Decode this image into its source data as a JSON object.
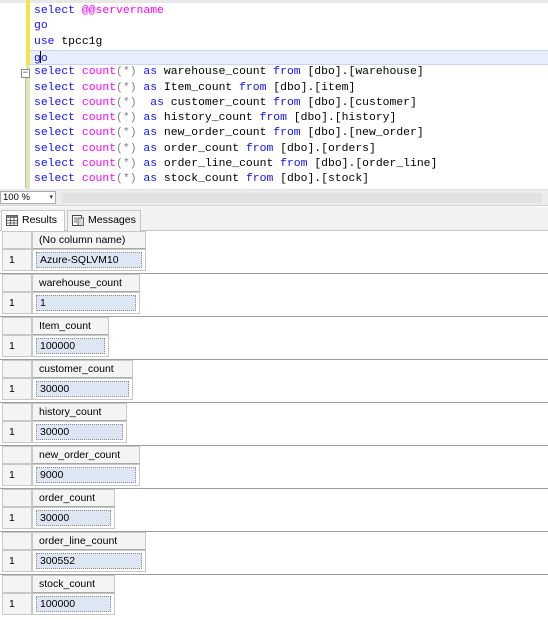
{
  "editor": {
    "lines": [
      {
        "parts": [
          [
            "kw",
            "select "
          ],
          [
            "at",
            "@@servername"
          ]
        ]
      },
      {
        "parts": [
          [
            "kw",
            "go"
          ]
        ]
      },
      {
        "parts": [
          [
            "kw",
            "use "
          ],
          [
            "pl",
            "tpcc1g"
          ]
        ]
      },
      {
        "parts": [
          [
            "kw",
            "go"
          ]
        ],
        "current": true
      },
      {
        "parts": [
          [
            "kw",
            "select "
          ],
          [
            "fn",
            "count"
          ],
          [
            "gy",
            "(*)"
          ],
          [
            "kw",
            " as "
          ],
          [
            "pl",
            "warehouse_count "
          ],
          [
            "kw",
            "from "
          ],
          [
            "pl",
            "[dbo].[warehouse]"
          ]
        ]
      },
      {
        "parts": [
          [
            "kw",
            "select "
          ],
          [
            "fn",
            "count"
          ],
          [
            "gy",
            "(*)"
          ],
          [
            "kw",
            " as "
          ],
          [
            "pl",
            "Item_count "
          ],
          [
            "kw",
            "from "
          ],
          [
            "pl",
            "[dbo].[item]"
          ]
        ]
      },
      {
        "parts": [
          [
            "kw",
            "select "
          ],
          [
            "fn",
            "count"
          ],
          [
            "gy",
            "(*)"
          ],
          [
            "kw",
            "  as "
          ],
          [
            "pl",
            "customer_count "
          ],
          [
            "kw",
            "from "
          ],
          [
            "pl",
            "[dbo].[customer]"
          ]
        ]
      },
      {
        "parts": [
          [
            "kw",
            "select "
          ],
          [
            "fn",
            "count"
          ],
          [
            "gy",
            "(*)"
          ],
          [
            "kw",
            " as "
          ],
          [
            "pl",
            "history_count "
          ],
          [
            "kw",
            "from "
          ],
          [
            "pl",
            "[dbo].[history]"
          ]
        ]
      },
      {
        "parts": [
          [
            "kw",
            "select "
          ],
          [
            "fn",
            "count"
          ],
          [
            "gy",
            "(*)"
          ],
          [
            "kw",
            " as "
          ],
          [
            "pl",
            "new_order_count "
          ],
          [
            "kw",
            "from "
          ],
          [
            "pl",
            "[dbo].[new_order]"
          ]
        ]
      },
      {
        "parts": [
          [
            "kw",
            "select "
          ],
          [
            "fn",
            "count"
          ],
          [
            "gy",
            "(*)"
          ],
          [
            "kw",
            " as "
          ],
          [
            "pl",
            "order_count "
          ],
          [
            "kw",
            "from "
          ],
          [
            "pl",
            "[dbo].[orders]"
          ]
        ]
      },
      {
        "parts": [
          [
            "kw",
            "select "
          ],
          [
            "fn",
            "count"
          ],
          [
            "gy",
            "(*)"
          ],
          [
            "kw",
            " as "
          ],
          [
            "pl",
            "order_line_count "
          ],
          [
            "kw",
            "from "
          ],
          [
            "pl",
            "[dbo].[order_line]"
          ]
        ]
      },
      {
        "parts": [
          [
            "kw",
            "select "
          ],
          [
            "fn",
            "count"
          ],
          [
            "gy",
            "(*)"
          ],
          [
            "kw",
            " as "
          ],
          [
            "pl",
            "stock_count "
          ],
          [
            "kw",
            "from "
          ],
          [
            "pl",
            "[dbo].[stock]"
          ]
        ]
      }
    ],
    "collapse_glyph": "−"
  },
  "zoom": {
    "value": "100 %",
    "arrow": "▾"
  },
  "tabs": {
    "results": "Results",
    "messages": "Messages"
  },
  "results": [
    {
      "column": "(No column name)",
      "row": "1",
      "value": "Azure-SQLVM10"
    },
    {
      "column": "warehouse_count",
      "row": "1",
      "value": "1"
    },
    {
      "column": "Item_count",
      "row": "1",
      "value": "100000"
    },
    {
      "column": "customer_count",
      "row": "1",
      "value": "30000"
    },
    {
      "column": "history_count",
      "row": "1",
      "value": "30000"
    },
    {
      "column": "new_order_count",
      "row": "1",
      "value": "9000"
    },
    {
      "column": "order_count",
      "row": "1",
      "value": "30000"
    },
    {
      "column": "order_line_count",
      "row": "1",
      "value": "300552"
    },
    {
      "column": "stock_count",
      "row": "1",
      "value": "100000"
    }
  ],
  "colors": {
    "keyword": "#1010ff",
    "function": "#ff00ff",
    "operator": "#7f7f7f",
    "selected_cell": "#dde6f2"
  }
}
